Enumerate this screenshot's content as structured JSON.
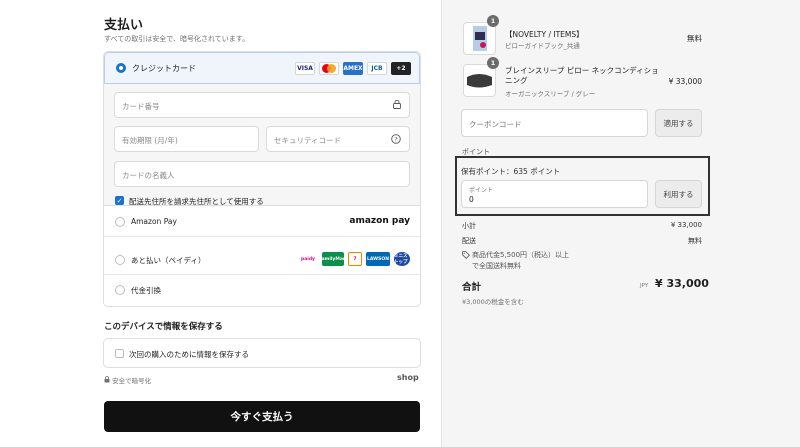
{
  "payment": {
    "title": "支払い",
    "subtitle": "すべての取引は安全で、暗号化されています。",
    "credit_card_label": "クレジットカード",
    "card_brands": [
      "VISA",
      "mastercard",
      "AMEX",
      "JCB",
      "+2"
    ],
    "card_number_placeholder": "カード番号",
    "expiry_placeholder": "有効期限 (月/年)",
    "security_code_placeholder": "セキュリティコード",
    "cardholder_placeholder": "カードの名義人",
    "use_shipping_as_billing": "配送先住所を請求先住所として使用する",
    "amazon_pay_label": "Amazon Pay",
    "amazon_pay_logo": "amazon pay",
    "atobarai_label": "あと払い（ペイディ）",
    "atobarai_brands": [
      "paidy",
      "FamilyMart",
      "7",
      "LAWSON",
      "ミニストップ"
    ],
    "cod_label": "代金引換"
  },
  "save_info": {
    "title": "このデバイスで情報を保存する",
    "checkbox_label": "次回の購入のために情報を保存する",
    "secure_text": "安全で暗号化",
    "shop_logo": "shop"
  },
  "pay_button": "今すぐ支払う",
  "order": {
    "items": [
      {
        "qty": "1",
        "name": "【NOVELTY / ITEMS】",
        "variant": "ピローガイドブック_共通",
        "price": "無料"
      },
      {
        "qty": "1",
        "name": "ブレインスリープ ピロー ネックコンディショニング",
        "variant": "オーガニックスリーブ / グレー",
        "price": "¥ 33,000"
      }
    ],
    "coupon_placeholder": "クーポンコード",
    "coupon_button": "適用する",
    "points_section_label": "ポイント",
    "points_owned": "保有ポイント：635 ポイント",
    "points_input_label": "ポイント",
    "points_input_value": "0",
    "points_button": "利用する",
    "subtotal_label": "小計",
    "subtotal_value": "¥ 33,000",
    "shipping_label": "配送",
    "shipping_value": "無料",
    "free_shipping_note_1": "商品代金5,500円（税込）以上",
    "free_shipping_note_2": "で全国送料無料",
    "total_label": "合計",
    "currency": "JPY",
    "total_value": "¥ 33,000",
    "tax_note": "¥3,000の税金を含む"
  },
  "colors": {
    "accent": "#1a73c7",
    "pay_button": "#111111",
    "summary_bg": "#f5f5f5"
  }
}
